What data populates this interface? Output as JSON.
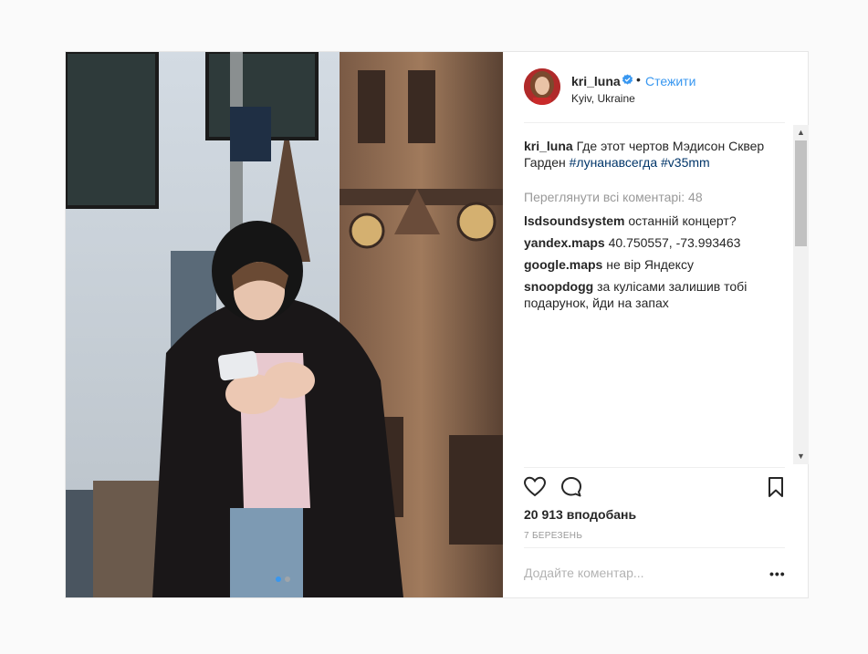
{
  "post": {
    "username": "kri_luna",
    "separator": "•",
    "follow_label": "Стежити",
    "location": "Kyiv, Ukraine",
    "caption": {
      "username": "kri_luna",
      "text": "Где этот чертов Мэдисон Сквер Гарден",
      "hashtags": [
        "#лунанавсегда",
        "#v35mm"
      ]
    },
    "view_all_comments": "Переглянути всі коментарі: 48",
    "comments": [
      {
        "username": "lsdsoundsystem",
        "text": "останній концерт?"
      },
      {
        "username": "yandex.maps",
        "text": "40.750557, -73.993463"
      },
      {
        "username": "google.maps",
        "text": "не вір Яндексу"
      },
      {
        "username": "snoopdogg",
        "text": "за кулісами залишив тобі подарунок, йди на запах"
      }
    ],
    "likes": "20 913 вподобань",
    "date": "7 березень",
    "add_comment_placeholder": "Додайте коментар...",
    "more_label": "•••",
    "carousel": {
      "total": 2,
      "active": 1
    }
  },
  "icons": {
    "like": "heart-icon",
    "comment": "comment-icon",
    "save": "bookmark-icon",
    "verified": "verified-badge-icon",
    "scroll_up": "scroll-up-icon",
    "scroll_down": "scroll-down-icon"
  },
  "colors": {
    "link": "#3897f0",
    "hashtag": "#003569",
    "muted": "#999999",
    "text": "#262626"
  }
}
